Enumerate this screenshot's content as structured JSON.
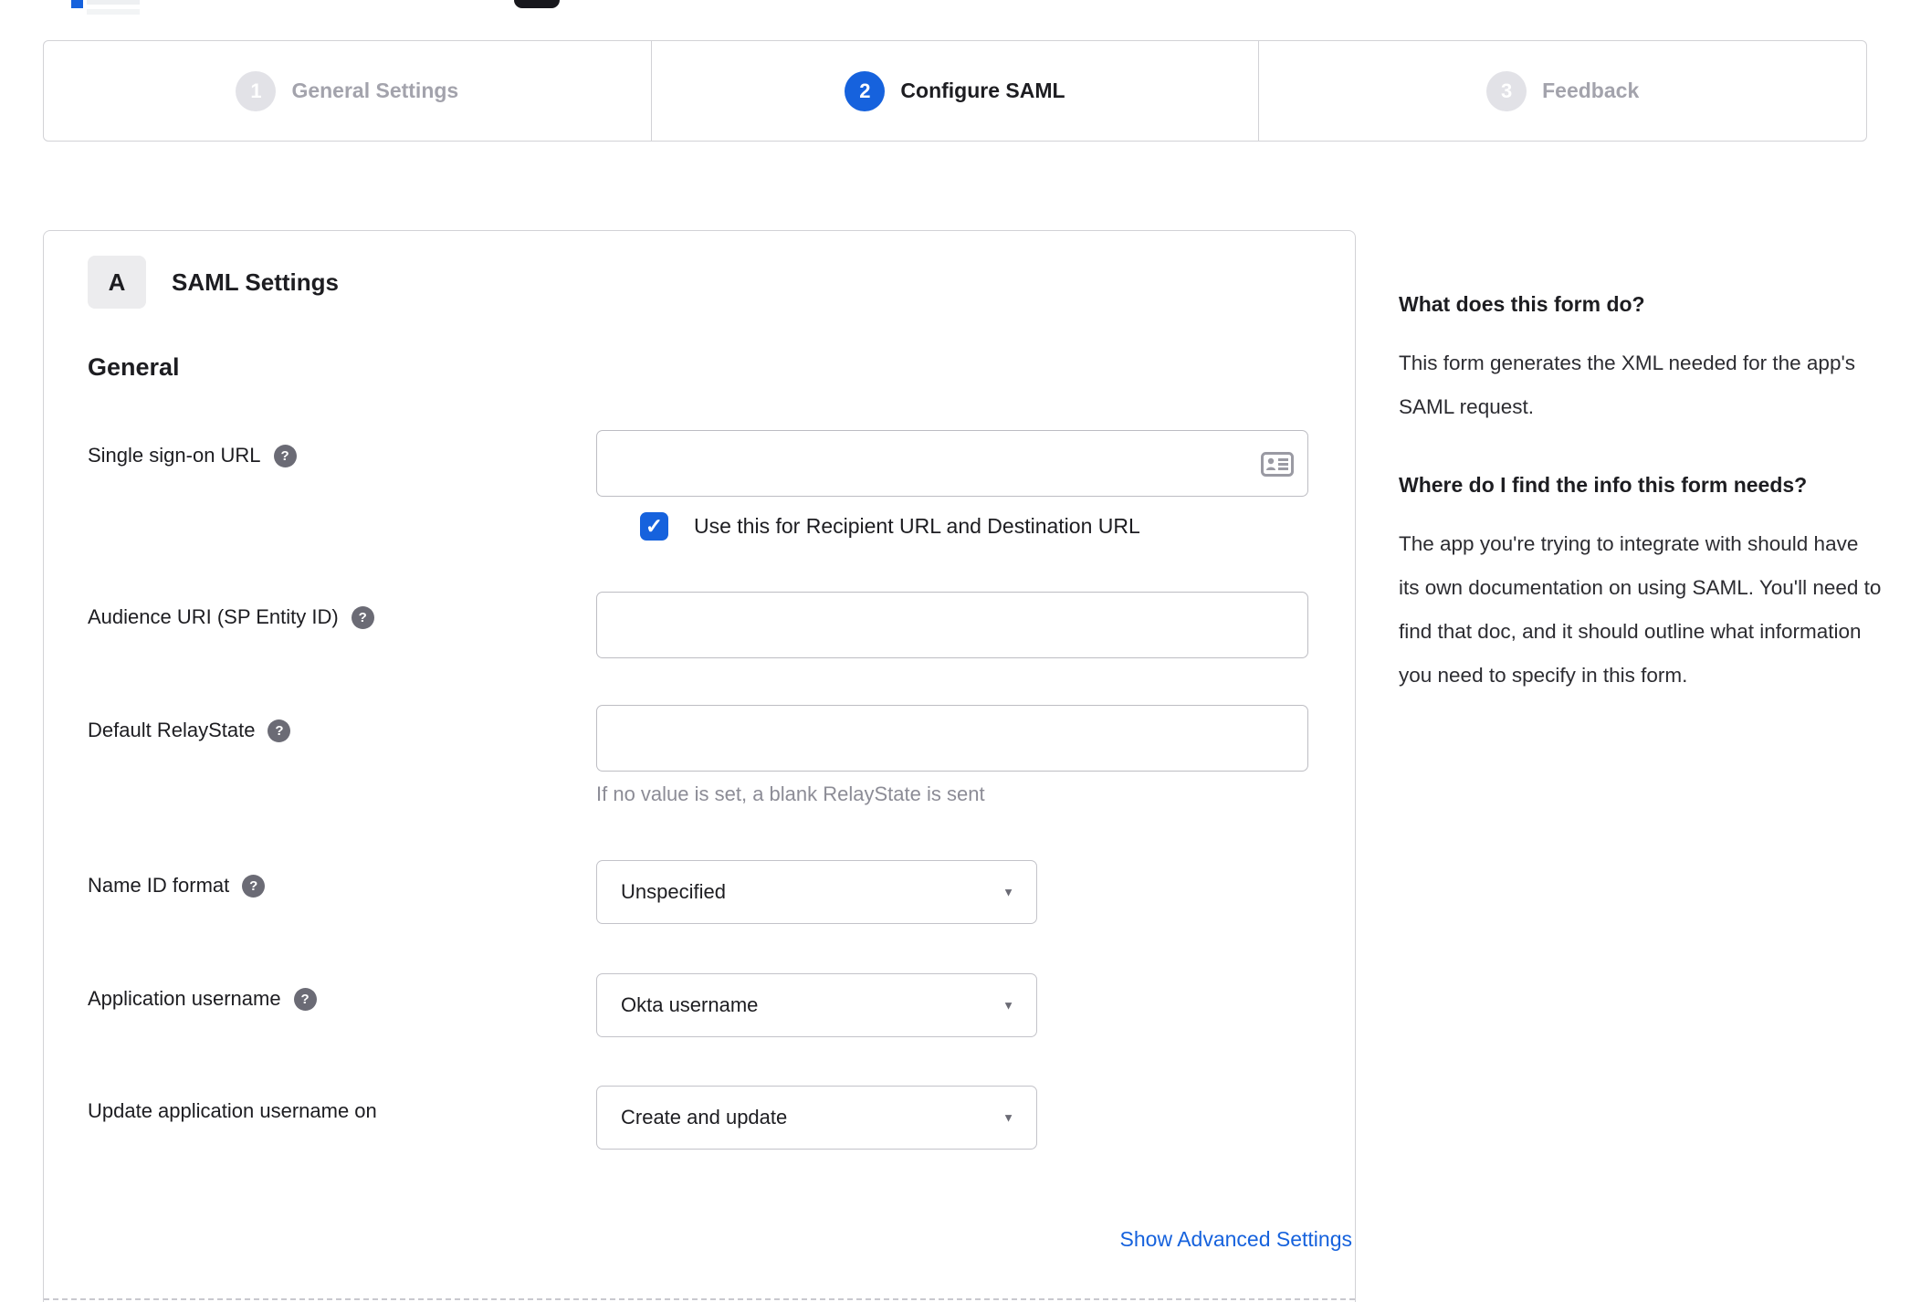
{
  "stepper": {
    "active_step": 2,
    "steps": [
      {
        "number": "1",
        "label": "General Settings",
        "state": "inactive"
      },
      {
        "number": "2",
        "label": "Configure SAML",
        "state": "active"
      },
      {
        "number": "3",
        "label": "Feedback",
        "state": "inactive"
      }
    ]
  },
  "panel": {
    "section_badge": "A",
    "section_title": "SAML Settings",
    "group_title": "General",
    "fields": [
      {
        "label": "Single sign-on URL",
        "has_help": true,
        "type": "text",
        "value": ""
      },
      {
        "label": "Audience URI (SP Entity ID)",
        "has_help": true,
        "type": "text",
        "value": ""
      },
      {
        "label": "Default RelayState",
        "has_help": true,
        "type": "text",
        "value": "",
        "hint": "If no value is set, a blank RelayState is sent"
      },
      {
        "label": "Name ID format",
        "has_help": true,
        "type": "select",
        "value": "Unspecified"
      },
      {
        "label": "Application username",
        "has_help": true,
        "type": "select",
        "value": "Okta username"
      },
      {
        "label": "Update application username on",
        "has_help": false,
        "type": "select",
        "value": "Create and update"
      }
    ],
    "checkbox": {
      "label": "Use this for Recipient URL and Destination URL",
      "checked": true
    },
    "advanced_link": "Show Advanced Settings"
  },
  "sidebar": {
    "sections": [
      {
        "heading": "What does this form do?",
        "body": "This form generates the XML needed for the app's SAML request."
      },
      {
        "heading": "Where do I find the info this form needs?",
        "body": "The app you're trying to integrate with should have its own documentation on using SAML. You'll need to find that doc, and it should outline what information you need to specify in this form."
      }
    ]
  },
  "icons": {
    "help_glyph": "?",
    "checkmark_glyph": "✓",
    "caret_glyph": "▼"
  },
  "colors": {
    "accent_blue": "#1662dd",
    "inactive_step_gray": "#e2e2e7",
    "inactive_text_gray": "#a3a3ac",
    "text_dark": "#1d1d21",
    "muted_text": "#8c8c96",
    "border_gray": "#d2d2d6"
  }
}
